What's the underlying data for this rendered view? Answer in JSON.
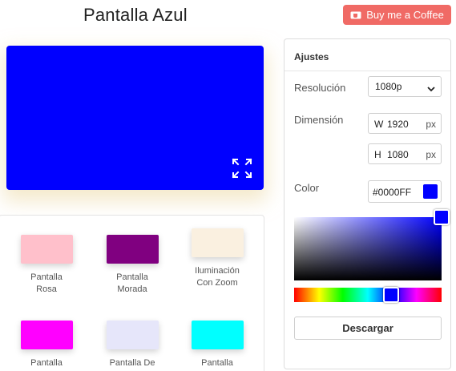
{
  "header": {
    "title": "Pantalla Azul",
    "coffee_label": "Buy me a Coffee"
  },
  "preview": {
    "color": "#0000ff",
    "fullscreen_icon": "expand-icon"
  },
  "gallery": {
    "items": [
      {
        "label": "Pantalla Rosa",
        "color": "#ffc0cb"
      },
      {
        "label": "Pantalla Morada",
        "color": "#800080"
      },
      {
        "label": "Iluminación Con Zoom",
        "color": "#faf0e0"
      },
      {
        "label": "Pantalla",
        "color": "#ff00ff"
      },
      {
        "label": "Pantalla De",
        "color": "#e6e6fa"
      },
      {
        "label": "Pantalla",
        "color": "#00ffff"
      }
    ]
  },
  "settings": {
    "title": "Ajustes",
    "resolution_label": "Resolución",
    "resolution_value": "1080p",
    "dimension_label": "Dimensión",
    "width_prefix": "W",
    "width_value": "1920",
    "height_prefix": "H",
    "height_value": "1080",
    "unit": "px",
    "color_label": "Color",
    "color_hex": "#0000FF",
    "hue_position": 0.66,
    "download_label": "Descargar"
  },
  "colors": {
    "accent": "#f06a65",
    "selected": "#0000ff"
  }
}
